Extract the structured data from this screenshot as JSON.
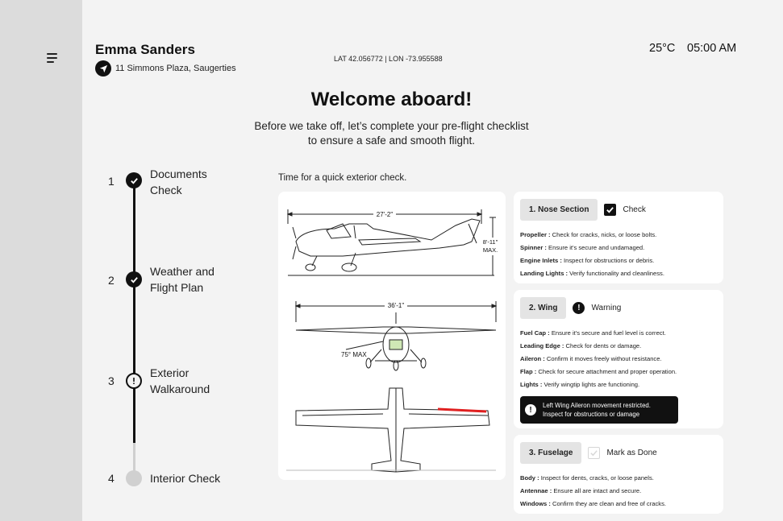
{
  "user": {
    "name": "Emma Sanders",
    "address": "11 Simmons Plaza, Saugerties"
  },
  "header": {
    "coords": "LAT 42.056772 | LON -73.955588",
    "temperature": "25°C",
    "time": "05:00 AM"
  },
  "intro": {
    "title": "Welcome aboard!",
    "subtitle_line1": "Before we take off, let’s complete your pre-flight checklist",
    "subtitle_line2": "to ensure a safe and smooth flight."
  },
  "steps": [
    {
      "number": "1",
      "label_line1": "Documents",
      "label_line2": "Check",
      "state": "done"
    },
    {
      "number": "2",
      "label_line1": "Weather and",
      "label_line2": "Flight Plan",
      "state": "done"
    },
    {
      "number": "3",
      "label_line1": "Exterior",
      "label_line2": "Walkaround",
      "state": "current"
    },
    {
      "number": "4",
      "label_line1": "Interior Check",
      "label_line2": "",
      "state": "todo"
    }
  ],
  "exterior": {
    "prompt": "Time for a quick exterior check.",
    "diagram": {
      "length": "27'-2\"",
      "height_line1": "8'-11\"",
      "height_line2": "MAX.",
      "span": "36'-1\"",
      "flap": "75° MAX"
    }
  },
  "sections": [
    {
      "title": "1. Nose Section",
      "status": "Check",
      "status_type": "checked",
      "items": [
        {
          "name": "Propeller :",
          "text": " Check for cracks, nicks, or loose bolts."
        },
        {
          "name": "Spinner :",
          "text": " Ensure it's secure and undamaged."
        },
        {
          "name": "Engine Inlets :",
          "text": " Inspect for obstructions or debris."
        },
        {
          "name": "Landing Lights :",
          "text": " Verify functionality and cleanliness."
        }
      ]
    },
    {
      "title": "2. Wing",
      "status": "Warning",
      "status_type": "warning",
      "items": [
        {
          "name": "Fuel Cap :",
          "text": " Ensure it's secure and fuel level is correct."
        },
        {
          "name": "Leading Edge :",
          "text": " Check for dents or damage."
        },
        {
          "name": "Aileron :",
          "text": " Confirm it moves freely without resistance."
        },
        {
          "name": "Flap :",
          "text": " Check for secure attachment and proper operation."
        },
        {
          "name": "Lights :",
          "text": " Verify wingtip lights are functioning."
        }
      ],
      "alert_line1": "Left Wing Aileron movement restricted.",
      "alert_line2": "Inspect for obstructions or damage"
    },
    {
      "title": "3. Fuselage",
      "status": "Mark as Done",
      "status_type": "unchecked",
      "items": [
        {
          "name": "Body :",
          "text": " Inspect for dents, cracks, or loose panels."
        },
        {
          "name": "Antennae :",
          "text": " Ensure all are intact and secure."
        },
        {
          "name": "Windows :",
          "text": " Confirm they are clean and free of cracks."
        }
      ]
    }
  ],
  "colors": {
    "sidebar": "#dcdcdc",
    "background": "#f3f3f3",
    "card": "#ffffff",
    "accent": "#111111",
    "warning_highlight": "#e02020"
  }
}
